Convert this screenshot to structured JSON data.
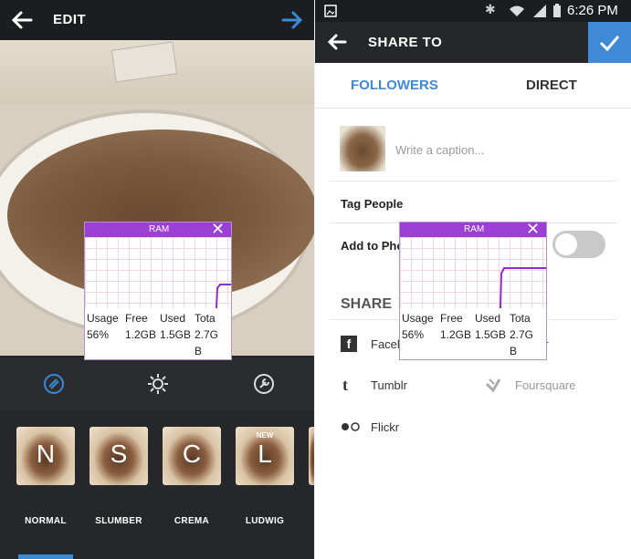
{
  "left": {
    "title": "EDIT",
    "icons": {
      "back": "back-arrow-icon",
      "next": "next-arrow-icon"
    },
    "tools": [
      "lux-icon",
      "brightness-icon",
      "settings-wrench-icon"
    ],
    "filters": [
      {
        "letter": "N",
        "label": "NORMAL"
      },
      {
        "letter": "S",
        "label": "SLUMBER"
      },
      {
        "letter": "C",
        "label": "CREMA"
      },
      {
        "letter": "L",
        "label": "LUDWIG",
        "badge": "NEW"
      }
    ],
    "accent": "#3a8ad6"
  },
  "ram_widget": {
    "title": "RAM",
    "headers": [
      "Usage",
      "Free",
      "Used",
      "Tota"
    ],
    "values": [
      "56%",
      "1.2GB",
      "1.5GB",
      "2.7G"
    ],
    "wrap": "B",
    "bar_color": "#9c3fd4"
  },
  "right": {
    "status_time": "6:26 PM",
    "title": "SHARE TO",
    "tabs": {
      "followers": "FOLLOWERS",
      "direct": "DIRECT"
    },
    "caption_placeholder": "Write a caption...",
    "tag_people": "Tag People",
    "add_to_photo": "Add to Pho",
    "share_heading": "SHARE",
    "services": {
      "facebook": "Facel",
      "twitter_tail": "er",
      "tumblr": "Tumblr",
      "foursquare": "Foursquare",
      "flickr": "Flickr"
    },
    "accent": "#3e8ad6"
  }
}
